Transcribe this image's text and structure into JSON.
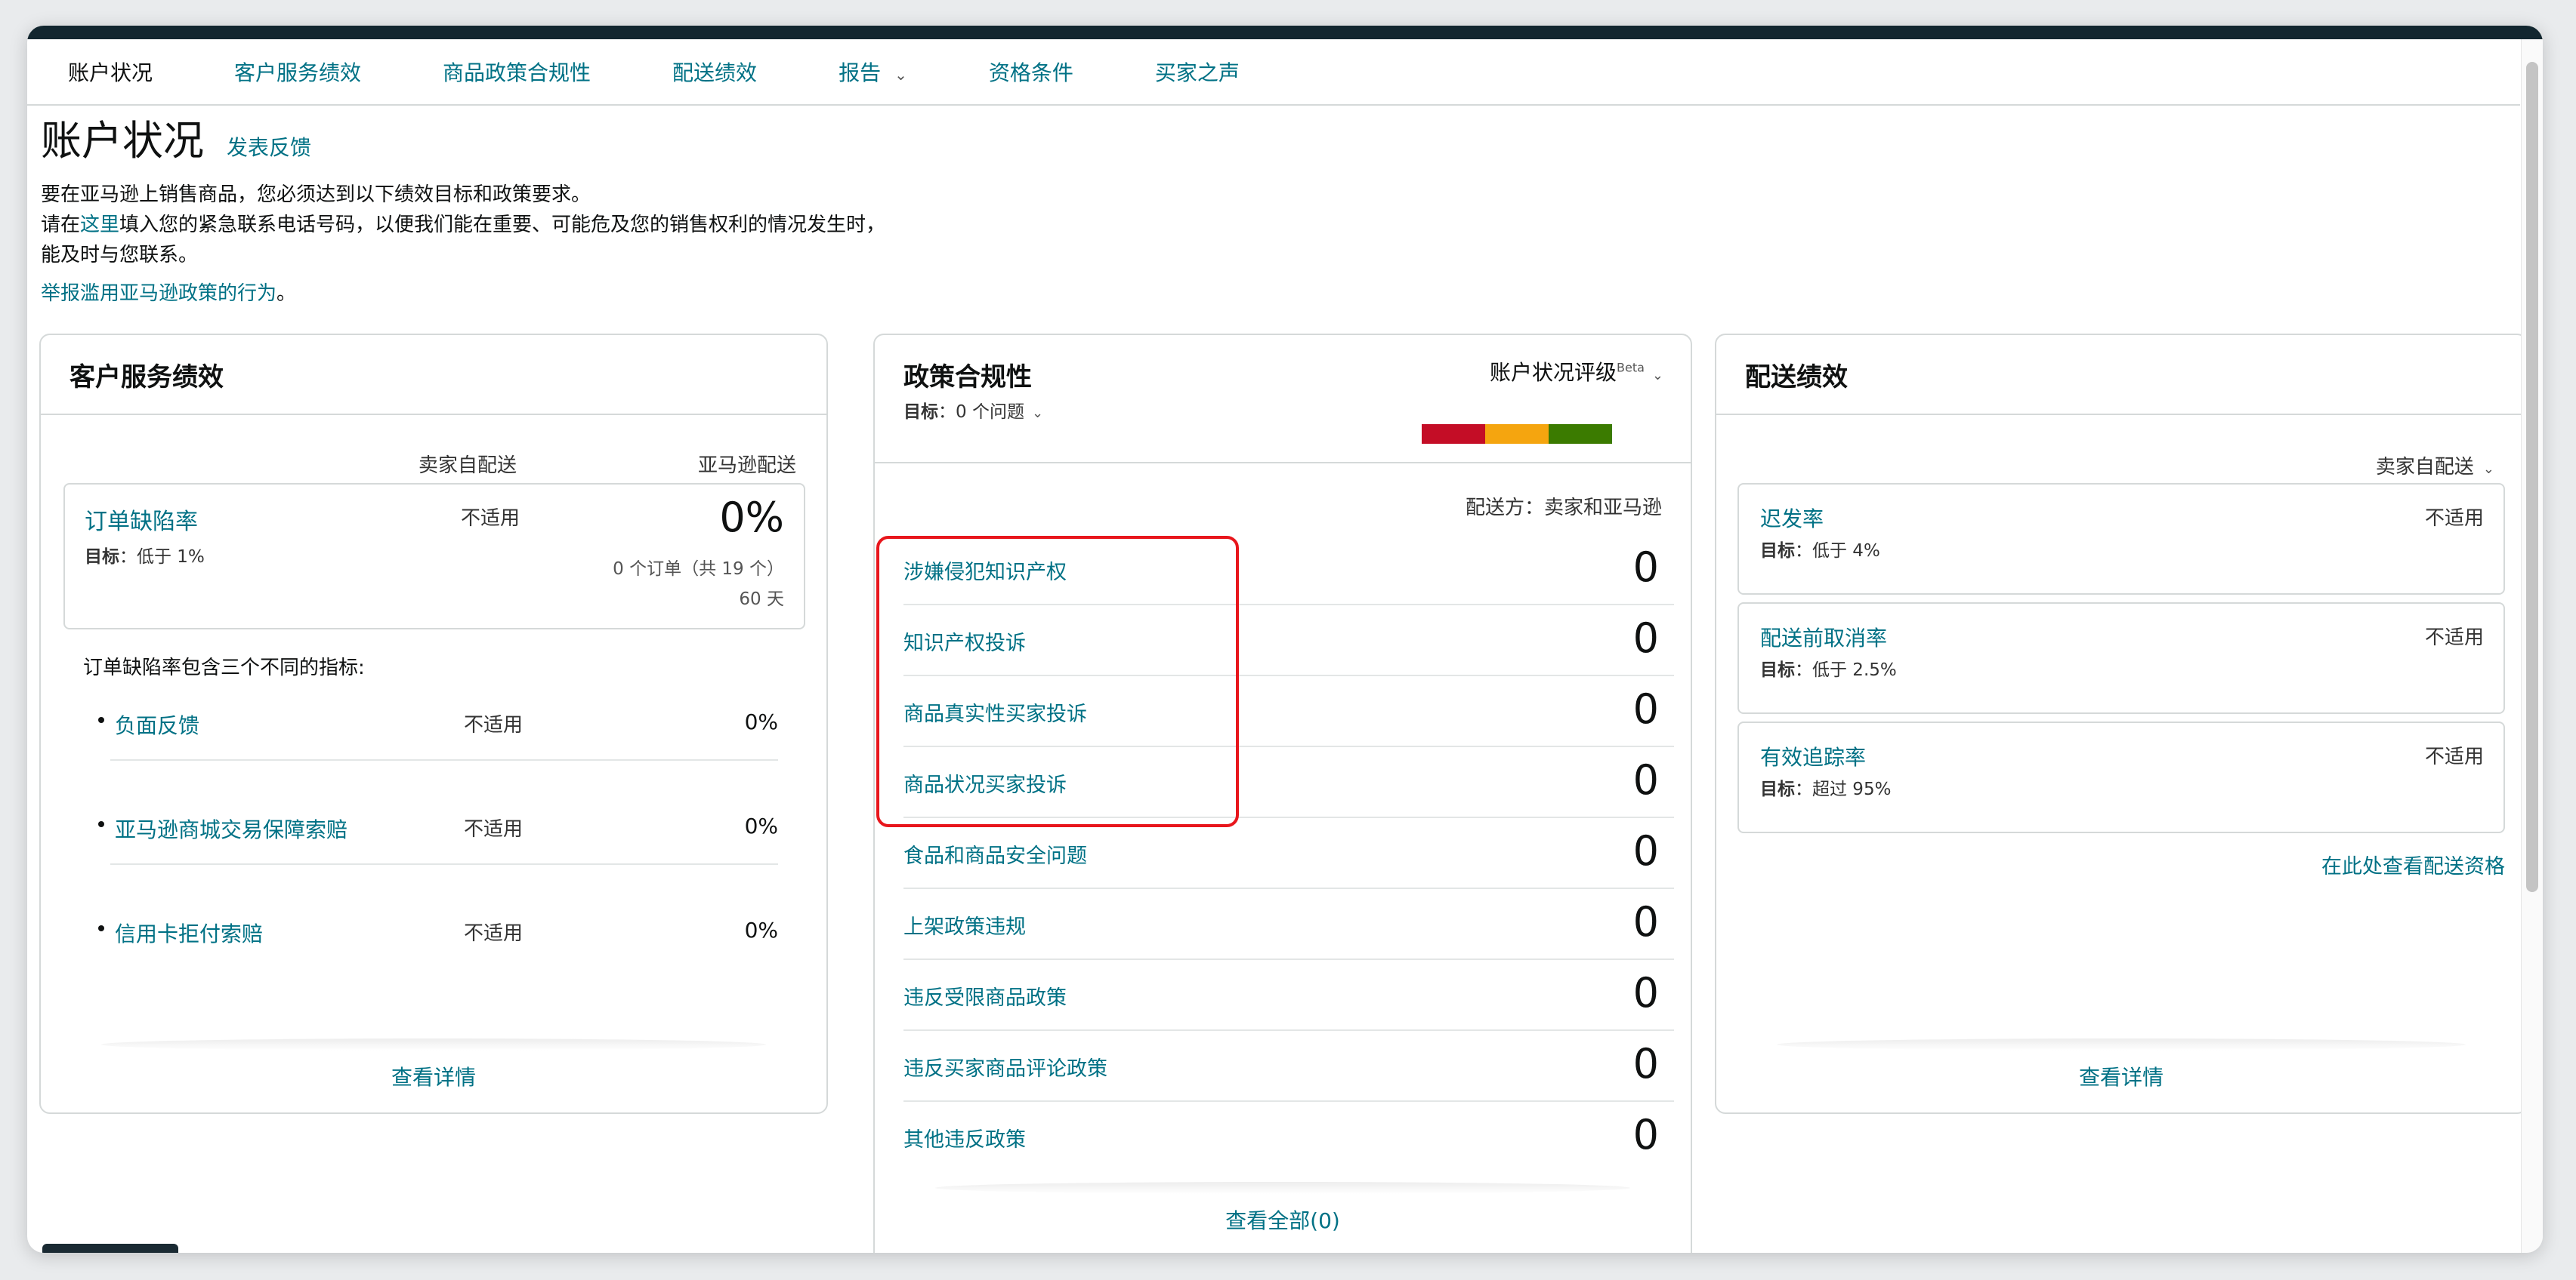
{
  "nav": {
    "tabs": [
      {
        "label": "账户状况"
      },
      {
        "label": "客户服务绩效"
      },
      {
        "label": "商品政策合规性"
      },
      {
        "label": "配送绩效"
      },
      {
        "label": "报告"
      },
      {
        "label": "资格条件"
      },
      {
        "label": "买家之声"
      }
    ]
  },
  "header": {
    "title": "账户状况",
    "feedback": "发表反馈",
    "intro_line1": "要在亚马逊上销售商品，您必须达到以下绩效目标和政策要求。",
    "intro_line2_pre": "请在",
    "intro_line2_link": "这里",
    "intro_line2_post": "填入您的紧急联系电话号码，以便我们能在重要、可能危及您的销售权利的情况发生时，能及时与您联系。",
    "report_link": "举报滥用亚马逊政策的行为",
    "report_dot": "。"
  },
  "customer_service": {
    "title": "客户服务绩效",
    "col_seller": "卖家自配送",
    "col_amazon": "亚马逊配送",
    "odr": {
      "name": "订单缺陷率",
      "target_label": "目标",
      "target_value": "：低于 1%",
      "seller_value": "不适用",
      "amazon_value": "0%",
      "orders": "0 个订单（共 19 个）",
      "days": "60 天"
    },
    "desc": "订单缺陷率包含三个不同的指标:",
    "items": [
      {
        "name": "负面反馈",
        "seller": "不适用",
        "amazon": "0%"
      },
      {
        "name": "亚马逊商城交易保障索赔",
        "seller": "不适用",
        "amazon": "0%"
      },
      {
        "name": "信用卡拒付索赔",
        "seller": "不适用",
        "amazon": "0%"
      }
    ],
    "details": "查看详情"
  },
  "policy": {
    "title": "政策合规性",
    "target_label": "目标",
    "target_value": "：0 个问题",
    "rating_label": "账户状况评级",
    "rating_beta": "Beta",
    "rating_colors": [
      "#c40d26",
      "#f5a50f",
      "#3b7b00"
    ],
    "fulfilment": "配送方：卖家和亚马逊",
    "items": [
      {
        "name": "涉嫌侵犯知识产权",
        "value": "0"
      },
      {
        "name": "知识产权投诉",
        "value": "0"
      },
      {
        "name": "商品真实性买家投诉",
        "value": "0"
      },
      {
        "name": "商品状况买家投诉",
        "value": "0"
      },
      {
        "name": "食品和商品安全问题",
        "value": "0"
      },
      {
        "name": "上架政策违规",
        "value": "0"
      },
      {
        "name": "违反受限商品政策",
        "value": "0"
      },
      {
        "name": "违反买家商品评论政策",
        "value": "0"
      },
      {
        "name": "其他违反政策",
        "value": "0"
      }
    ],
    "view_all": "查看全部(0)"
  },
  "shipping": {
    "title": "配送绩效",
    "selector": "卖家自配送",
    "items": [
      {
        "name": "迟发率",
        "target_label": "目标",
        "target_value": "：低于 4%",
        "value": "不适用"
      },
      {
        "name": "配送前取消率",
        "target_label": "目标",
        "target_value": "：低于 2.5%",
        "value": "不适用"
      },
      {
        "name": "有效追踪率",
        "target_label": "目标",
        "target_value": "：超过 95%",
        "value": "不适用"
      }
    ],
    "eligibility": "在此处查看配送资格",
    "details": "查看详情"
  }
}
